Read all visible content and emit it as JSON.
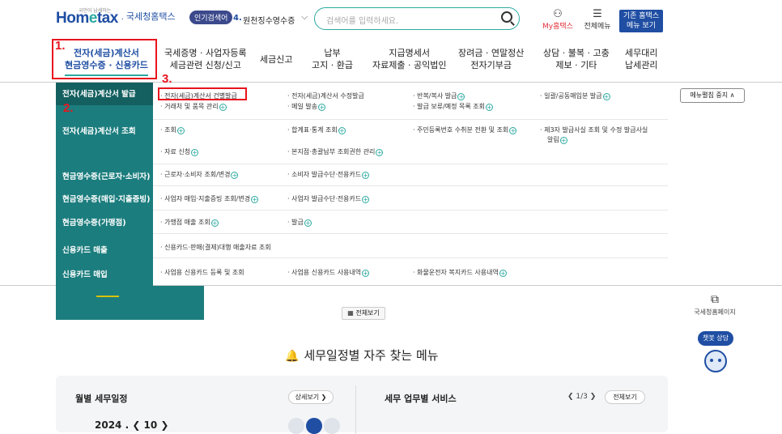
{
  "header": {
    "logo_small": "국민이 납세하는",
    "logo_main_a": "Hom",
    "logo_main_e": "e",
    "logo_main_b": "tax",
    "logo_sub": ". 국세청홈택스",
    "popular_badge": "인기검색어",
    "popular_num": "4.",
    "popular_text": "원천징수영수증",
    "search_placeholder": "검색어를 입력하세요.",
    "my_hometax": "My홈택스",
    "all_menu": "전체메뉴",
    "old_home_line1": "기존 홈택스",
    "old_home_line2": "메뉴 보기"
  },
  "gnb": [
    {
      "l1": "전자(세금)계산서",
      "l2": "현금영수증 · 신용카드"
    },
    {
      "l1": "국세증명 · 사업자등록",
      "l2": "세금관련 신청/신고"
    },
    {
      "l1": "세금신고",
      "l2": ""
    },
    {
      "l1": "납부",
      "l2": "고지 · 환급"
    },
    {
      "l1": "지급명세서",
      "l2": "자료제출 · 공익법인"
    },
    {
      "l1": "장려금 · 연말정산",
      "l2": "전자기부금"
    },
    {
      "l1": "상담 · 불복 · 고충",
      "l2": "제보 · 기타"
    },
    {
      "l1": "세무대리",
      "l2": "납세관리"
    }
  ],
  "annotations": {
    "one": "1.",
    "two": "2.",
    "three": "3."
  },
  "dropdown": {
    "categories": [
      "전자(세금)계산서 발급",
      "전자(세금)계산서 조회",
      "현금영수증(근로자·소비자)",
      "현금영수증(매입·지출증빙)",
      "현금영수증(가맹점)",
      "신용카드 매출",
      "신용카드 매입"
    ],
    "items": {
      "a1": "· 전자(세금)계산서 건별발급",
      "a2": "· 거래처 및 품목 관리",
      "a3": "· 전자(세금)계산서 수정발급",
      "a4": "· 메일 발송",
      "a5": "· 반복/복사 발급",
      "a6": "· 발급 보류/예정 목록 조회",
      "a7": "· 일괄/공동매입분 발급",
      "b1": "· 조회",
      "b2": "· 합계표·통계 조회",
      "b3": "· 주민등록번호 수취분 전환 및 조회",
      "b4": "· 제3자 발급사실 조회 및 수정 발급사실",
      "b4b": "알림",
      "b5": "· 자료 신청",
      "b6": "· 본지점·총괄납부 조회권한 관리",
      "c1": "· 근로자·소비자 조회/변경",
      "c2": "· 소비자 발급수단·전용카드",
      "d1": "· 사업자 매입·지출증빙 조회/변경",
      "d2": "· 사업자 발급수단·전용카드",
      "e1": "· 가맹점 매출 조회",
      "e2": "· 발급",
      "f1": "· 신용카드·판매(결제)대행 매출자료 조회",
      "g1": "· 사업용 신용카드 등록 및 조회",
      "g2": "· 사업용 신용카드 사용내역",
      "g3": "· 화물운전자 복지카드 사용내역"
    },
    "menu_pin": "메뉴펼침 중지 ∧"
  },
  "below": {
    "all_view": "전체보기",
    "side_home": "국세청홈페이지",
    "chatbot": "챗봇 상담",
    "section_title": "세무일정별 자주 찾는 메뉴",
    "monthly": "월별 세무일정",
    "detail": "상세보기 ❯",
    "service": "세무 업무별 서비스",
    "pager": "❮  1/3  ❯",
    "all_view2": "전체보기",
    "year": "2024 .  ❮  10  ❯"
  }
}
